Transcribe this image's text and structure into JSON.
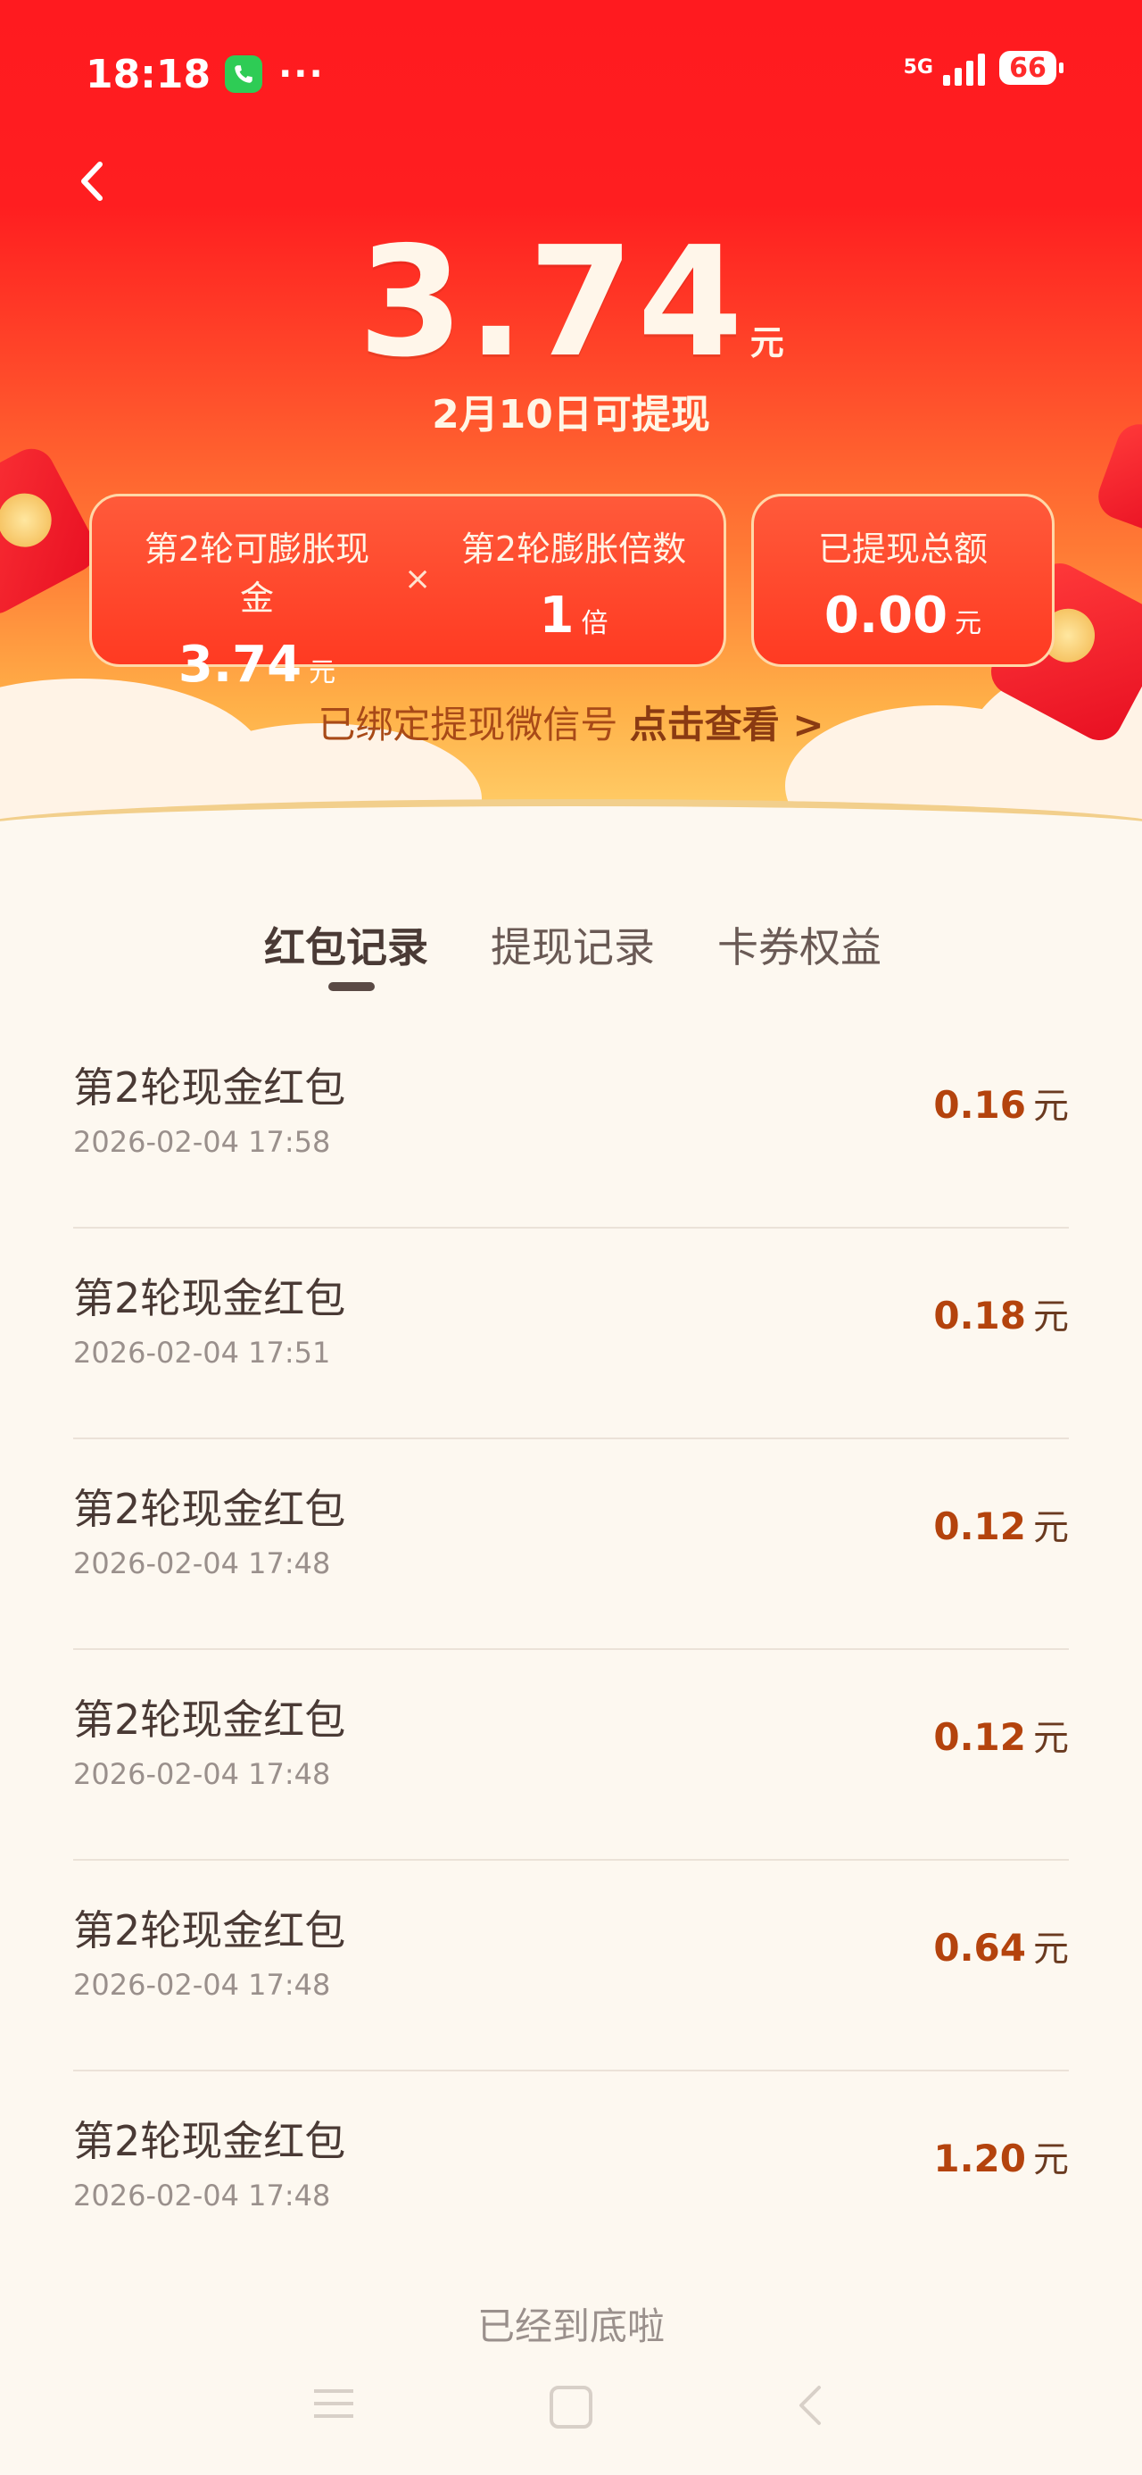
{
  "status_bar": {
    "time": "18:18",
    "call_icon": "phone-icon",
    "dots": "···",
    "network": "5G",
    "battery": "66"
  },
  "header": {
    "back_icon": "chevron-left-icon",
    "amount": "3.74",
    "amount_unit": "元",
    "subtitle": "2月10日可提现"
  },
  "summary": {
    "cash_label": "第2轮可膨胀现金",
    "cash_value": "3.74",
    "cash_unit": "元",
    "multiply_sign": "×",
    "multiplier_label": "第2轮膨胀倍数",
    "multiplier_value": "1",
    "multiplier_unit": "倍",
    "withdrawn_label": "已提现总额",
    "withdrawn_value": "0.00",
    "withdrawn_unit": "元"
  },
  "bind": {
    "text": "已绑定提现微信号",
    "link": "点击查看 >"
  },
  "tabs": [
    {
      "label": "红包记录",
      "active": true
    },
    {
      "label": "提现记录",
      "active": false
    },
    {
      "label": "卡券权益",
      "active": false
    }
  ],
  "records": [
    {
      "title": "第2轮现金红包",
      "time": "2026-02-04 17:58",
      "amount": "0.16",
      "unit": "元"
    },
    {
      "title": "第2轮现金红包",
      "time": "2026-02-04 17:51",
      "amount": "0.18",
      "unit": "元"
    },
    {
      "title": "第2轮现金红包",
      "time": "2026-02-04 17:48",
      "amount": "0.12",
      "unit": "元"
    },
    {
      "title": "第2轮现金红包",
      "time": "2026-02-04 17:48",
      "amount": "0.12",
      "unit": "元"
    },
    {
      "title": "第2轮现金红包",
      "time": "2026-02-04 17:48",
      "amount": "0.64",
      "unit": "元"
    },
    {
      "title": "第2轮现金红包",
      "time": "2026-02-04 17:48",
      "amount": "1.20",
      "unit": "元"
    }
  ],
  "footer": {
    "end_text": "已经到底啦"
  },
  "colors": {
    "header_red": "#ff1a1f",
    "amount_orange": "#b4430d",
    "page_bg": "#fdf8f0"
  }
}
